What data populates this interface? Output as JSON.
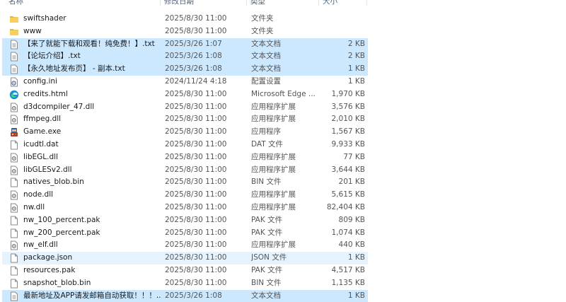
{
  "columns": {
    "name": "名称",
    "date": "修改日期",
    "type": "类型",
    "size": "大小"
  },
  "files": [
    {
      "name": "swiftshader",
      "date": "2025/8/30 11:00",
      "type": "文件夹",
      "size": "",
      "icon": "folder-icon",
      "state": ""
    },
    {
      "name": "www",
      "date": "2025/8/30 11:00",
      "type": "文件夹",
      "size": "",
      "icon": "folder-icon",
      "state": ""
    },
    {
      "name": "【来了就能下载和观看！纯免费！】.txt",
      "date": "2025/3/26 1:07",
      "type": "文本文档",
      "size": "2 KB",
      "icon": "text-file-icon",
      "state": "selected"
    },
    {
      "name": "【论坛介绍】.txt",
      "date": "2025/3/26 1:08",
      "type": "文本文档",
      "size": "2 KB",
      "icon": "text-file-icon",
      "state": "selected"
    },
    {
      "name": "【永久地址发布页】 - 副本.txt",
      "date": "2025/3/26 1:08",
      "type": "文本文档",
      "size": "1 KB",
      "icon": "text-file-icon",
      "state": "selected"
    },
    {
      "name": "config.ini",
      "date": "2024/11/24 4:18",
      "type": "配置设置",
      "size": "1 KB",
      "icon": "config-file-icon",
      "state": ""
    },
    {
      "name": "credits.html",
      "date": "2025/8/30 11:00",
      "type": "Microsoft Edge ...",
      "size": "1,970 KB",
      "icon": "edge-icon",
      "state": ""
    },
    {
      "name": "d3dcompiler_47.dll",
      "date": "2025/8/30 11:00",
      "type": "应用程序扩展",
      "size": "3,576 KB",
      "icon": "dll-file-icon",
      "state": ""
    },
    {
      "name": "ffmpeg.dll",
      "date": "2025/8/30 11:00",
      "type": "应用程序扩展",
      "size": "2,010 KB",
      "icon": "dll-file-icon",
      "state": ""
    },
    {
      "name": "Game.exe",
      "date": "2025/8/30 11:00",
      "type": "应用程序",
      "size": "1,567 KB",
      "icon": "game-exe-icon",
      "state": ""
    },
    {
      "name": "icudtl.dat",
      "date": "2025/8/30 11:00",
      "type": "DAT 文件",
      "size": "9,933 KB",
      "icon": "blank-file-icon",
      "state": ""
    },
    {
      "name": "libEGL.dll",
      "date": "2025/8/30 11:00",
      "type": "应用程序扩展",
      "size": "77 KB",
      "icon": "dll-file-icon",
      "state": ""
    },
    {
      "name": "libGLESv2.dll",
      "date": "2025/8/30 11:00",
      "type": "应用程序扩展",
      "size": "3,644 KB",
      "icon": "dll-file-icon",
      "state": ""
    },
    {
      "name": "natives_blob.bin",
      "date": "2025/8/30 11:00",
      "type": "BIN 文件",
      "size": "201 KB",
      "icon": "blank-file-icon",
      "state": ""
    },
    {
      "name": "node.dll",
      "date": "2025/8/30 11:00",
      "type": "应用程序扩展",
      "size": "5,615 KB",
      "icon": "dll-file-icon",
      "state": ""
    },
    {
      "name": "nw.dll",
      "date": "2025/8/30 11:00",
      "type": "应用程序扩展",
      "size": "82,404 KB",
      "icon": "dll-file-icon",
      "state": ""
    },
    {
      "name": "nw_100_percent.pak",
      "date": "2025/8/30 11:00",
      "type": "PAK 文件",
      "size": "809 KB",
      "icon": "blank-file-icon",
      "state": ""
    },
    {
      "name": "nw_200_percent.pak",
      "date": "2025/8/30 11:00",
      "type": "PAK 文件",
      "size": "1,074 KB",
      "icon": "blank-file-icon",
      "state": ""
    },
    {
      "name": "nw_elf.dll",
      "date": "2025/8/30 11:00",
      "type": "应用程序扩展",
      "size": "440 KB",
      "icon": "dll-file-icon",
      "state": ""
    },
    {
      "name": "package.json",
      "date": "2025/8/30 11:00",
      "type": "JSON 文件",
      "size": "1 KB",
      "icon": "blank-file-icon",
      "state": "hover"
    },
    {
      "name": "resources.pak",
      "date": "2025/8/30 11:00",
      "type": "PAK 文件",
      "size": "4,517 KB",
      "icon": "blank-file-icon",
      "state": ""
    },
    {
      "name": "snapshot_blob.bin",
      "date": "2025/8/30 11:00",
      "type": "BIN 文件",
      "size": "1,135 KB",
      "icon": "blank-file-icon",
      "state": ""
    },
    {
      "name": "最新地址及APP请发邮箱自动获取！！！....",
      "date": "2025/3/26 1:08",
      "type": "文本文档",
      "size": "1 KB",
      "icon": "text-file-icon",
      "state": "selected"
    }
  ]
}
